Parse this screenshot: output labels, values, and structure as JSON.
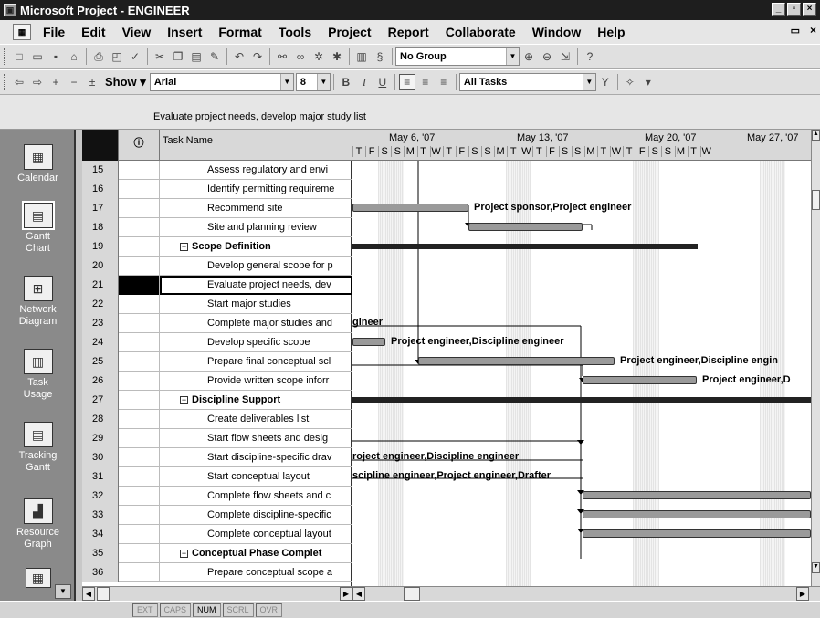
{
  "window": {
    "title": "Microsoft Project - ENGINEER"
  },
  "menu": [
    "File",
    "Edit",
    "View",
    "Insert",
    "Format",
    "Tools",
    "Project",
    "Report",
    "Collaborate",
    "Window",
    "Help"
  ],
  "toolbar1": {
    "group_value": "No Group"
  },
  "toolbar2": {
    "show_label": "Show",
    "font": "Arial",
    "size": "8",
    "filter": "All Tasks"
  },
  "entry_bar": {
    "text": "Evaluate project needs, develop major study list"
  },
  "view_bar": [
    {
      "label": "Calendar",
      "icon": "calendar-icon"
    },
    {
      "label": "Gantt Chart",
      "icon": "gantt-chart-icon"
    },
    {
      "label": "Network Diagram",
      "icon": "network-diagram-icon"
    },
    {
      "label": "Task Usage",
      "icon": "task-usage-icon"
    },
    {
      "label": "Tracking Gantt",
      "icon": "tracking-gantt-icon"
    },
    {
      "label": "Resource Graph",
      "icon": "resource-graph-icon"
    }
  ],
  "sheet": {
    "header_name": "Task Name"
  },
  "tasks": [
    {
      "id": "15",
      "name": "Assess regulatory and envi",
      "indent": 2
    },
    {
      "id": "16",
      "name": "Identify permitting requireme",
      "indent": 2
    },
    {
      "id": "17",
      "name": "Recommend site",
      "indent": 2
    },
    {
      "id": "18",
      "name": "Site and planning review",
      "indent": 2
    },
    {
      "id": "19",
      "name": "Scope Definition",
      "indent": 1,
      "summary": true
    },
    {
      "id": "20",
      "name": "Develop general scope for p",
      "indent": 2
    },
    {
      "id": "21",
      "name": "Evaluate project needs, dev",
      "indent": 2,
      "selected": true
    },
    {
      "id": "22",
      "name": "Start major studies",
      "indent": 2
    },
    {
      "id": "23",
      "name": "Complete major studies and",
      "indent": 2
    },
    {
      "id": "24",
      "name": "Develop specific scope",
      "indent": 2
    },
    {
      "id": "25",
      "name": "Prepare final conceptual scl",
      "indent": 2
    },
    {
      "id": "26",
      "name": "Provide written scope inforr",
      "indent": 2
    },
    {
      "id": "27",
      "name": "Discipline Support",
      "indent": 1,
      "summary": true
    },
    {
      "id": "28",
      "name": "Create deliverables list",
      "indent": 2
    },
    {
      "id": "29",
      "name": "Start flow sheets and desig",
      "indent": 2
    },
    {
      "id": "30",
      "name": "Start discipline-specific drav",
      "indent": 2
    },
    {
      "id": "31",
      "name": "Start conceptual layout",
      "indent": 2
    },
    {
      "id": "32",
      "name": "Complete flow sheets and c",
      "indent": 2
    },
    {
      "id": "33",
      "name": "Complete discipline-specific",
      "indent": 2
    },
    {
      "id": "34",
      "name": "Complete conceptual layout",
      "indent": 2
    },
    {
      "id": "35",
      "name": "Conceptual Phase Complet",
      "indent": 1,
      "summary": true
    },
    {
      "id": "36",
      "name": "Prepare conceptual scope a",
      "indent": 2
    }
  ],
  "gantt": {
    "weeks": [
      "May 6, '07",
      "May 13, '07",
      "May 20, '07",
      "May 27, '07"
    ],
    "days": [
      "T",
      "F",
      "S",
      "S",
      "M",
      "T",
      "W",
      "T",
      "F",
      "S",
      "S",
      "M",
      "T",
      "W",
      "T",
      "F",
      "S",
      "S",
      "M",
      "T",
      "W",
      "T",
      "F",
      "S",
      "S",
      "M",
      "T",
      "W"
    ],
    "labels": {
      "r17": "Project sponsor,Project engineer",
      "r23": "gineer",
      "r24": "Project engineer,Discipline engineer",
      "r25": "Project engineer,Discipline engin",
      "r26": "Project engineer,D",
      "r30": "roject engineer,Discipline engineer",
      "r31": "scipline engineer,Project engineer,Drafter"
    }
  },
  "status": {
    "cells": [
      "EXT",
      "CAPS",
      "NUM",
      "SCRL",
      "OVR"
    ],
    "active": "NUM"
  }
}
